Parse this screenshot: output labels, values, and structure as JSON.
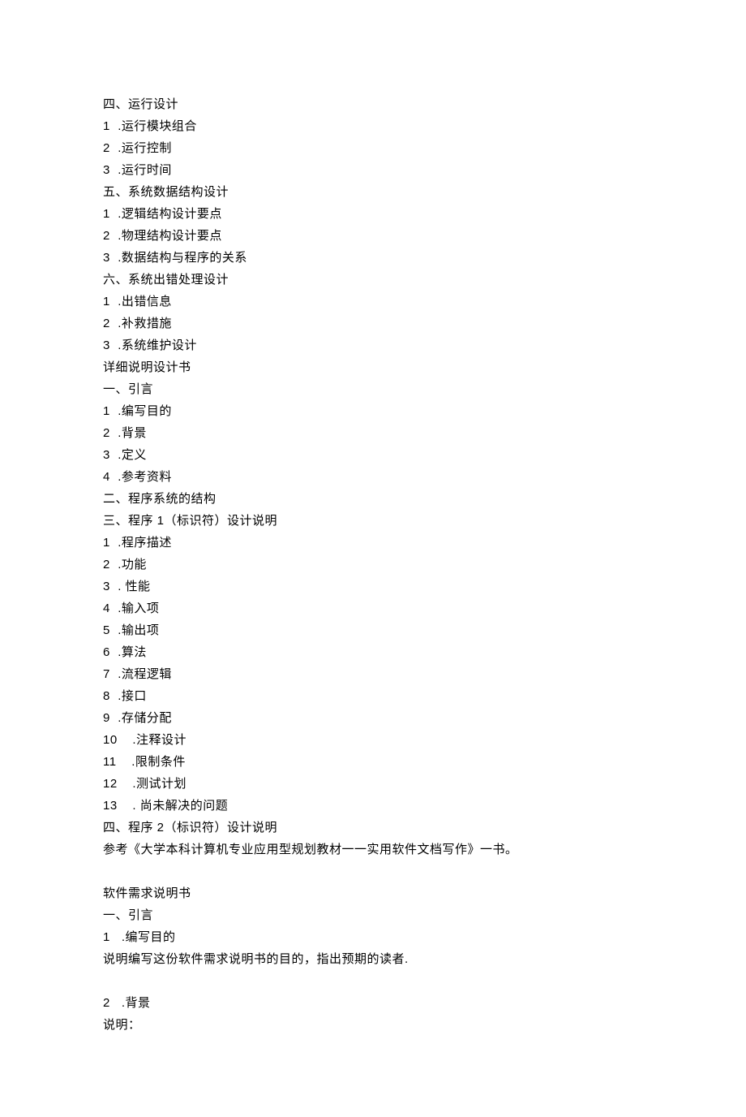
{
  "lines": [
    {
      "type": "heading",
      "text": "四、运行设计"
    },
    {
      "type": "numitem",
      "num": "1",
      "text": ".运行模块组合"
    },
    {
      "type": "numitem",
      "num": "2",
      "text": ".运行控制"
    },
    {
      "type": "numitem",
      "num": "3",
      "text": ".运行时间"
    },
    {
      "type": "heading",
      "text": "五、系统数据结构设计"
    },
    {
      "type": "numitem",
      "num": "1",
      "text": ".逻辑结构设计要点"
    },
    {
      "type": "numitem",
      "num": "2",
      "text": ".物理结构设计要点"
    },
    {
      "type": "numitem",
      "num": "3",
      "text": ".数据结构与程序的关系"
    },
    {
      "type": "heading",
      "text": "六、系统出错处理设计"
    },
    {
      "type": "numitem",
      "num": "1",
      "text": ".出错信息"
    },
    {
      "type": "numitem",
      "num": "2",
      "text": ".补救措施"
    },
    {
      "type": "numitem",
      "num": "3",
      "text": ".系统维护设计"
    },
    {
      "type": "heading",
      "text": "详细说明设计书"
    },
    {
      "type": "heading",
      "text": "一、引言"
    },
    {
      "type": "numitem",
      "num": "1",
      "text": ".编写目的"
    },
    {
      "type": "numitem",
      "num": "2",
      "text": ".背景"
    },
    {
      "type": "numitem",
      "num": "3",
      "text": ".定义"
    },
    {
      "type": "numitem",
      "num": "4",
      "text": ".参考资料"
    },
    {
      "type": "heading",
      "text": "二、程序系统的结构"
    },
    {
      "type": "mixed",
      "pre": "三、程序 ",
      "num": "1",
      "post": "（标识符）设计说明"
    },
    {
      "type": "numitem",
      "num": "1",
      "text": ".程序描述"
    },
    {
      "type": "numitem",
      "num": "2",
      "text": ".功能"
    },
    {
      "type": "numitem",
      "num": "3",
      "text": ". 性能"
    },
    {
      "type": "numitem",
      "num": "4",
      "text": ".输入项"
    },
    {
      "type": "numitem",
      "num": "5",
      "text": ".输出项"
    },
    {
      "type": "numitem",
      "num": "6",
      "text": ".算法"
    },
    {
      "type": "numitem",
      "num": "7",
      "text": ".流程逻辑"
    },
    {
      "type": "numitem",
      "num": "8",
      "text": ".接口"
    },
    {
      "type": "numitem",
      "num": "9",
      "text": ".存储分配"
    },
    {
      "type": "numitem",
      "num": "10",
      "text": "  .注释设计"
    },
    {
      "type": "numitem",
      "num": "11",
      "text": "  .限制条件"
    },
    {
      "type": "numitem",
      "num": "12",
      "text": "  .测试计划"
    },
    {
      "type": "numitem",
      "num": "13",
      "text": "  . 尚未解决的问题"
    },
    {
      "type": "mixed",
      "pre": "四、程序 ",
      "num": "2",
      "post": "（标识符）设计说明"
    },
    {
      "type": "heading",
      "text": "参考《大学本科计算机专业应用型规划教材一一实用软件文档写作》一书。"
    },
    {
      "type": "blank"
    },
    {
      "type": "heading",
      "text": "软件需求说明书"
    },
    {
      "type": "heading",
      "text": "一、引言"
    },
    {
      "type": "numitem",
      "num": "1",
      "text": " .编写目的"
    },
    {
      "type": "heading",
      "text": "说明编写这份软件需求说明书的目的，指出预期的读者."
    },
    {
      "type": "blank"
    },
    {
      "type": "numitem",
      "num": "2",
      "text": " .背景"
    },
    {
      "type": "heading",
      "text": "说明："
    }
  ]
}
